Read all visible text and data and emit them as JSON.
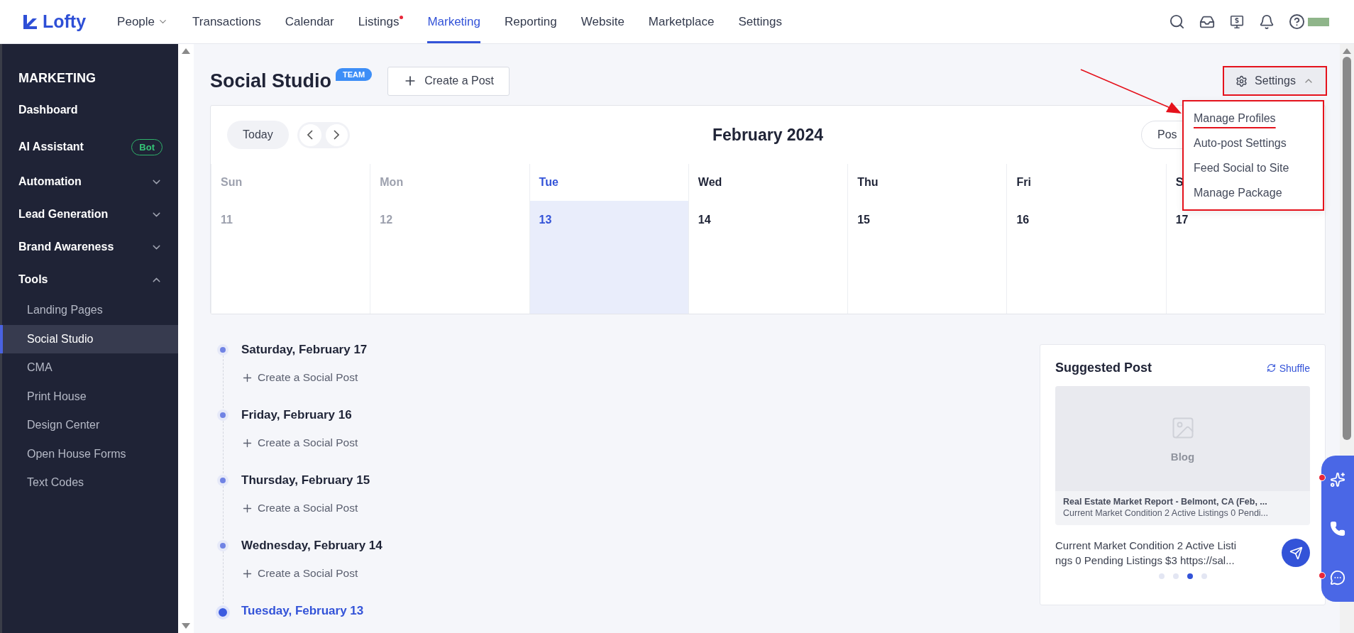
{
  "brand": {
    "name": "Lofty"
  },
  "nav": [
    {
      "label": "People",
      "selected": false,
      "dropdown": true,
      "dot": false
    },
    {
      "label": "Transactions",
      "selected": false,
      "dropdown": false,
      "dot": false
    },
    {
      "label": "Calendar",
      "selected": false,
      "dropdown": false,
      "dot": false
    },
    {
      "label": "Listings",
      "selected": false,
      "dropdown": false,
      "dot": true
    },
    {
      "label": "Marketing",
      "selected": true,
      "dropdown": false,
      "dot": false
    },
    {
      "label": "Reporting",
      "selected": false,
      "dropdown": false,
      "dot": false
    },
    {
      "label": "Website",
      "selected": false,
      "dropdown": false,
      "dot": false
    },
    {
      "label": "Marketplace",
      "selected": false,
      "dropdown": false,
      "dot": false
    },
    {
      "label": "Settings",
      "selected": false,
      "dropdown": false,
      "dot": false
    }
  ],
  "sidebar": {
    "title": "MARKETING",
    "items": [
      {
        "label": "Dashboard",
        "kind": "link"
      },
      {
        "label": "AI Assistant",
        "kind": "link",
        "badge": "Bot"
      },
      {
        "label": "Automation",
        "kind": "group",
        "expanded": false
      },
      {
        "label": "Lead Generation",
        "kind": "group",
        "expanded": false
      },
      {
        "label": "Brand Awareness",
        "kind": "group",
        "expanded": false
      },
      {
        "label": "Tools",
        "kind": "group",
        "expanded": true,
        "children": [
          {
            "label": "Landing Pages",
            "selected": false
          },
          {
            "label": "Social Studio",
            "selected": true
          },
          {
            "label": "CMA",
            "selected": false
          },
          {
            "label": "Print House",
            "selected": false
          },
          {
            "label": "Design Center",
            "selected": false
          },
          {
            "label": "Open House Forms",
            "selected": false
          },
          {
            "label": "Text Codes",
            "selected": false
          }
        ]
      }
    ]
  },
  "page": {
    "title": "Social Studio",
    "badge": "TEAM",
    "create_button": "Create a Post",
    "settings": {
      "label": "Settings",
      "expanded": true,
      "highlighted": true,
      "menu_highlighted": true,
      "menu": [
        {
          "label": "Manage Profiles",
          "underlined": true
        },
        {
          "label": "Auto-post Settings",
          "underlined": false
        },
        {
          "label": "Feed Social to Site",
          "underlined": false
        },
        {
          "label": "Manage Package",
          "underlined": false
        }
      ]
    }
  },
  "calendar": {
    "today": "Today",
    "month": "February 2024",
    "view_button": "Pos",
    "days": [
      {
        "name": "Sun",
        "date": "11",
        "past": true,
        "selected": false
      },
      {
        "name": "Mon",
        "date": "12",
        "past": true,
        "selected": false
      },
      {
        "name": "Tue",
        "date": "13",
        "past": false,
        "selected": true
      },
      {
        "name": "Wed",
        "date": "14",
        "past": false,
        "selected": false
      },
      {
        "name": "Thu",
        "date": "15",
        "past": false,
        "selected": false
      },
      {
        "name": "Fri",
        "date": "16",
        "past": false,
        "selected": false
      },
      {
        "name": "S",
        "date": "17",
        "past": false,
        "selected": false
      }
    ]
  },
  "timeline": [
    {
      "date": "Saturday, February 17",
      "action": "Create a Social Post",
      "selected": false
    },
    {
      "date": "Friday, February 16",
      "action": "Create a Social Post",
      "selected": false
    },
    {
      "date": "Thursday, February 15",
      "action": "Create a Social Post",
      "selected": false
    },
    {
      "date": "Wednesday, February 14",
      "action": "Create a Social Post",
      "selected": false
    },
    {
      "date": "Tuesday, February 13",
      "selected": true
    }
  ],
  "suggested": {
    "title": "Suggested Post",
    "shuffle": "Shuffle",
    "preview_label": "Blog",
    "preview_title": "Real Estate Market Report - Belmont, CA (Feb, ...",
    "preview_text": "Current Market Condition 2 Active Listings 0 Pendi...",
    "caption_lines": [
      "Current Market Condition 2 Active Listi",
      "ngs 0 Pending Listings $3 https://sal..."
    ],
    "dots": [
      {
        "selected": false
      },
      {
        "selected": false
      },
      {
        "selected": true
      },
      {
        "selected": false
      }
    ]
  },
  "widget": [
    {
      "kind": "ai",
      "alert": true
    },
    {
      "kind": "phone",
      "alert": false
    },
    {
      "kind": "chat",
      "alert": true
    }
  ]
}
